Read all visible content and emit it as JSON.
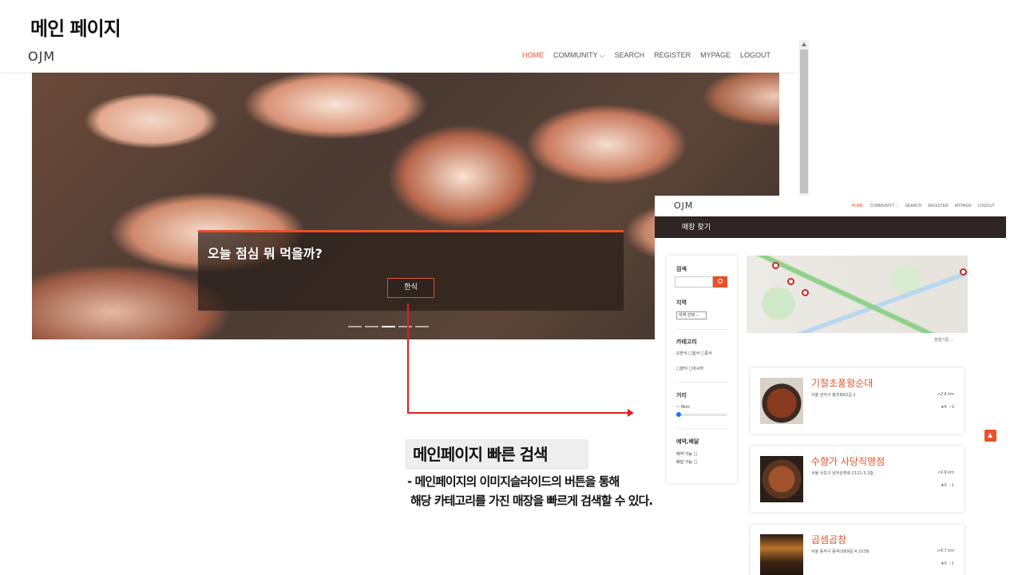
{
  "slide": {
    "title": "메인 페이지"
  },
  "main_page": {
    "logo": "OJM",
    "menu": [
      "HOME",
      "COMMUNITY ⌵",
      "SEARCH",
      "REGISTER",
      "MYPAGE",
      "LOGOUT"
    ],
    "hero": {
      "question": "오늘 점심 뭐 먹을까?",
      "button": "한식",
      "slides_total": 5,
      "slide_active": 3
    }
  },
  "explanation": {
    "title": "메인페이지 빠른 검색",
    "line1": "- 메인페이지의 이미지슬라이드의 버튼을 통해",
    "line2": "해당 카테고리를 가진 매장을 빠르게 검색할 수 있다."
  },
  "search_page": {
    "logo": "OJM",
    "menu": [
      "HOME",
      "COMMUNITY ⌵",
      "SEARCH",
      "REGISTER",
      "MYPAGE",
      "LOGOUT"
    ],
    "banner": "매장 찾기",
    "sidebar": {
      "search_label": "검색",
      "region_label": "지역",
      "region_select": "지역 선택 ⌵",
      "category_label": "카테고리",
      "category_row1": "☑한식 □일식 □중식",
      "category_row2": "□양식 □아시아",
      "distance_label": "거리",
      "distance_value": "~ 0km",
      "order_label": "예약,배달",
      "reserve": "예약 가능 □",
      "delivery": "배달 가능 □"
    },
    "sort": "정렬기준 ⌵",
    "stores": [
      {
        "name": "기절초풍왕순대",
        "address": "서울 관악구 봉천로62길 2",
        "distance": "➚2.6 km",
        "stats": "★4 ♢0"
      },
      {
        "name": "수향가 사당직영점",
        "address": "서울 서초구 남부순환로 2121-3 2층",
        "distance": "➚4.9 km",
        "stats": "★0 ♢1"
      },
      {
        "name": "곱셈곱창",
        "address": "서울 동작구 동작대로9길 4 103호",
        "distance": "➚4.7 km",
        "stats": "★0 ♢1"
      }
    ]
  },
  "colors": {
    "accent": "#e8512a",
    "banner": "#2f2624",
    "arrow": "#e02020"
  }
}
